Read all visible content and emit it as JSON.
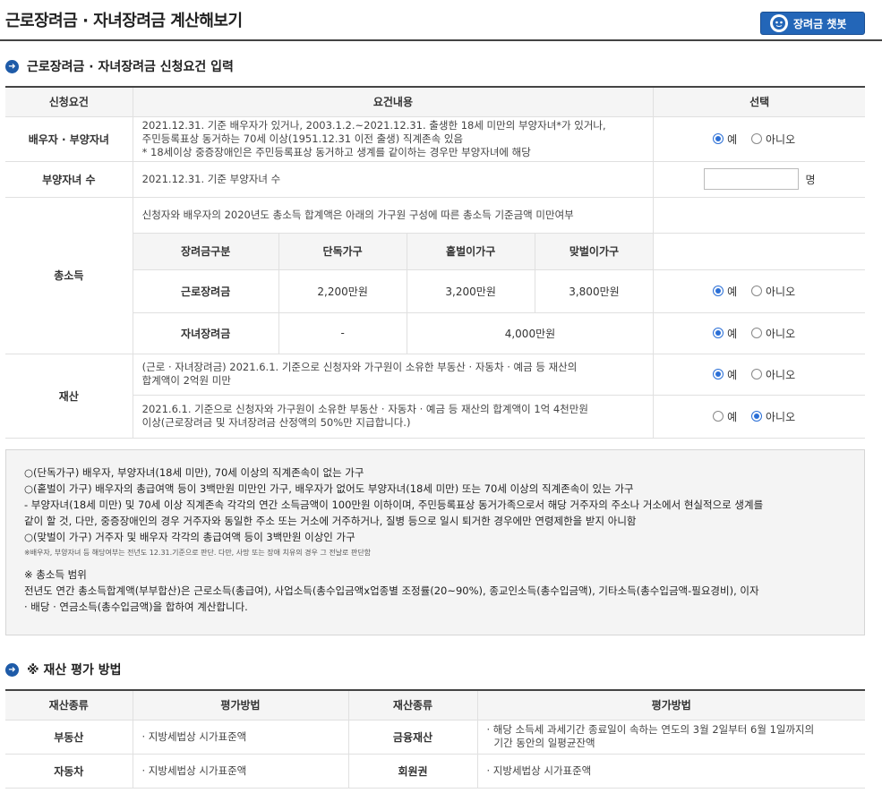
{
  "header": {
    "title": "근로장려금 · 자녀장려금 계산해보기",
    "chatbot_label": "장려금 챗봇"
  },
  "section1": {
    "title": "근로장려금 · 자녀장려금 신청요건 입력"
  },
  "req_table": {
    "headers": [
      "신청요건",
      "요건내용",
      "선택"
    ],
    "spouse": {
      "label": "배우자 · 부양자녀",
      "lines": [
        "2021.12.31. 기준 배우자가 있거나, 2003.1.2.~2021.12.31. 출생한 18세 미만의 부양자녀*가 있거나,",
        "주민등록표상 동거하는 70세 이상(1951.12.31 이전 출생) 직계존속 있음",
        "* 18세이상 중증장애인은 주민등록표상 동거하고 생계를 같이하는 경우만 부양자녀에 해당"
      ]
    },
    "children": {
      "label": "부양자녀 수",
      "content": "2021.12.31. 기준 부양자녀 수",
      "input_value": "",
      "unit": "명"
    },
    "income": {
      "label": "총소득",
      "intro": "신청자와 배우자의 2020년도 총소득 합계액은 아래의 가구원 구성에 따른 총소득 기준금액 미만여부",
      "sub_headers": [
        "장려금구분",
        "단독가구",
        "홑벌이가구",
        "맞벌이가구"
      ],
      "rows": [
        {
          "name": "근로장려금",
          "single": "2,200만원",
          "one": "3,200만원",
          "dual": "3,800만원"
        },
        {
          "name": "자녀장려금",
          "single": "-",
          "merged": "4,000만원"
        }
      ]
    },
    "property": {
      "label": "재산",
      "row1": [
        "(근로 · 자녀장려금) 2021.6.1. 기준으로 신청자와 가구원이 소유한 부동산 · 자동차 · 예금 등 재산의",
        "합계액이 2억원 미만"
      ],
      "row2": [
        "2021.6.1. 기준으로 신청자와 가구원이 소유한 부동산 · 자동차 · 예금 등 재산의 합계액이 1억 4천만원",
        "이상(근로장려금 및 자녀장려금 산정액의 50%만 지급합니다.)"
      ]
    },
    "yes": "예",
    "no": "아니오"
  },
  "notes": {
    "lines": [
      "○(단독가구) 배우자, 부양자녀(18세 미만), 70세 이상의 직계존속이 없는 가구",
      "○(홑벌이 가구) 배우자의 총급여액 등이 3백만원 미만인 가구, 배우자가 없어도 부양자녀(18세 미만) 또는 70세 이상의 직계존속이 있는 가구",
      "- 부양자녀(18세 미만) 및 70세 이상 직계존속 각각의 연간 소득금액이 100만원 이하이며, 주민등록표상 동거가족으로서 해당 거주자의 주소나 거소에서 현실적으로 생계를",
      "같이 할 것, 다만, 중증장애인의 경우 거주자와 동일한 주소 또는 거소에 거주하거나, 질병 등으로 일시 퇴거한 경우에만 연령제한을 받지 아니함",
      "○(맞벌이 가구) 거주자 및 배우자 각각의 총급여액 등이 3백만원 이상인 가구"
    ],
    "small": "※배우자, 부양자녀 등 해당여부는 전년도 12.31.기준으로 판단. 다만, 사망 또는 장애 치유의 경우 그 전날로 판단함",
    "scope_title": "※ 총소득 범위",
    "scope_lines": [
      "전년도 연간 총소득합계액(부부합산)은 근로소득(총급여), 사업소득(총수입금액x업종별 조정률(20~90%), 종교인소득(총수입금액), 기타소득(총수입금액-필요경비), 이자",
      "· 배당 · 연금소득(총수입금액)을 합하여 계산합니다."
    ]
  },
  "section2": {
    "title": "※ 재산 평가 방법"
  },
  "asset_table": {
    "headers": [
      "재산종류",
      "평가방법",
      "재산종류",
      "평가방법"
    ],
    "rows": [
      {
        "k1": "부동산",
        "v1": "· 지방세법상 시가표준액",
        "k2": "금융재산",
        "v2": [
          "· 해당 소득세 과세기간 종료일이 속하는 연도의 3월 2일부터 6월 1일까지의",
          "기간 동안의 일평균잔액"
        ]
      },
      {
        "k1": "자동차",
        "v1": "· 지방세법상 시가표준액",
        "k2": "회원권",
        "v2": [
          "· 지방세법상 시가표준액"
        ]
      }
    ]
  }
}
